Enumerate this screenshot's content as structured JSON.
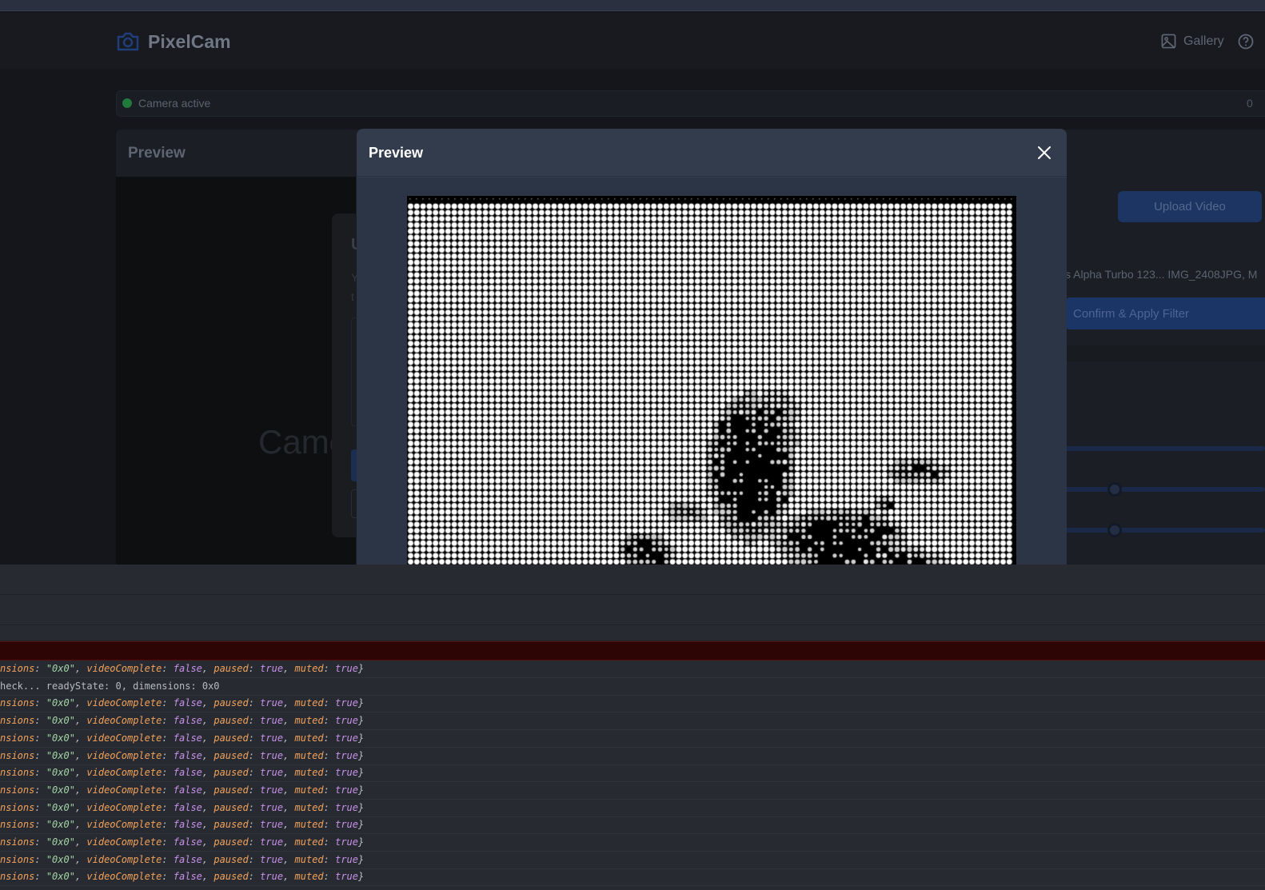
{
  "app": {
    "name": "PixelCam",
    "nav": {
      "gallery_label": "Gallery"
    },
    "status": {
      "text": "Camera active",
      "right": "0"
    },
    "panel_title": "Preview",
    "camera_ghost_text": "Camera",
    "ghost_dialog": {
      "title_initial": "U",
      "line1": "Y",
      "line2": "t"
    },
    "upload_label": "Upload Video",
    "file_list": "s Alpha Turbo 123... IMG_2408JPG, M",
    "confirm_label": "Confirm & Apply Filter"
  },
  "modal": {
    "title": "Preview",
    "close_icon": "close-icon",
    "image": "dot-matrix halftone rendering of a photo"
  },
  "console": {
    "rows": [
      {
        "type": "state"
      },
      {
        "type": "plain",
        "text": "heck... readyState: 0, dimensions: 0x0"
      },
      {
        "type": "state"
      },
      {
        "type": "state"
      },
      {
        "type": "state"
      },
      {
        "type": "state"
      },
      {
        "type": "state"
      },
      {
        "type": "state"
      },
      {
        "type": "state"
      },
      {
        "type": "state"
      },
      {
        "type": "state"
      },
      {
        "type": "state"
      },
      {
        "type": "state"
      }
    ],
    "state_parts": {
      "key1": "nsions",
      "val1": "\"0x0\"",
      "key2": "videoComplete",
      "val2": "false",
      "key3": "paused",
      "val3": "true",
      "key4": "muted",
      "val4": "true"
    }
  },
  "colors": {
    "accent": "#1d3562",
    "status_dot": "#1f7a3c",
    "modal_bg": "#323c4d",
    "error_row": "#2e0505"
  }
}
